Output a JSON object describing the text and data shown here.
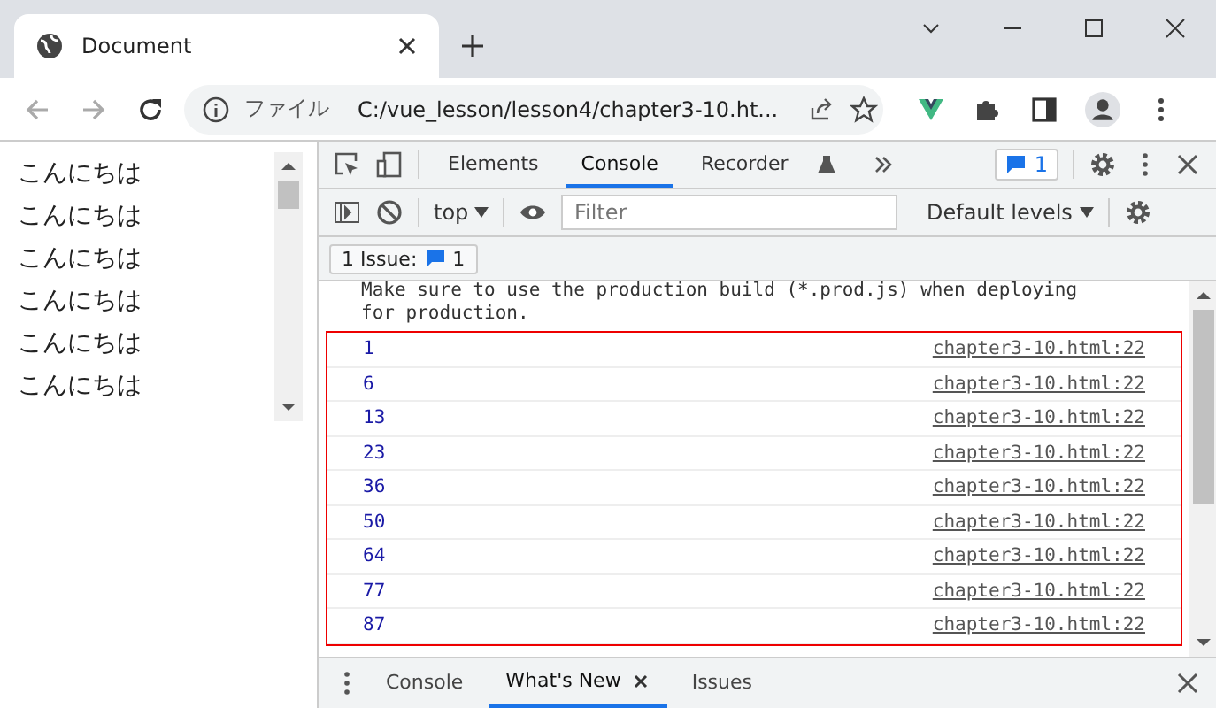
{
  "browser": {
    "tab_title": "Document",
    "address_scheme": "ファイル",
    "address": "C:/vue_lesson/lesson4/chapter3-10.ht..."
  },
  "page": {
    "lines": [
      "こんにちは",
      "こんにちは",
      "こんにちは",
      "こんにちは",
      "こんにちは",
      "こんにちは"
    ]
  },
  "devtools": {
    "tabs": [
      {
        "label": "Elements",
        "selected": false
      },
      {
        "label": "Console",
        "selected": true
      },
      {
        "label": "Recorder",
        "selected": false
      }
    ],
    "issues_badge": "1",
    "context": "top",
    "filter": {
      "placeholder": "Filter"
    },
    "levels": "Default levels",
    "issues_button": {
      "label": "1 Issue:",
      "count": "1"
    },
    "warning_text": "Make sure to use the production build (*.prod.js) when deploying for production.",
    "messages": [
      {
        "value": "1",
        "source": "chapter3-10.html:22"
      },
      {
        "value": "6",
        "source": "chapter3-10.html:22"
      },
      {
        "value": "13",
        "source": "chapter3-10.html:22"
      },
      {
        "value": "23",
        "source": "chapter3-10.html:22"
      },
      {
        "value": "36",
        "source": "chapter3-10.html:22"
      },
      {
        "value": "50",
        "source": "chapter3-10.html:22"
      },
      {
        "value": "64",
        "source": "chapter3-10.html:22"
      },
      {
        "value": "77",
        "source": "chapter3-10.html:22"
      },
      {
        "value": "87",
        "source": "chapter3-10.html:22"
      }
    ],
    "drawer_tabs": [
      {
        "label": "Console",
        "selected": false,
        "closable": false
      },
      {
        "label": "What's New",
        "selected": true,
        "closable": true
      },
      {
        "label": "Issues",
        "selected": false,
        "closable": false
      }
    ]
  }
}
